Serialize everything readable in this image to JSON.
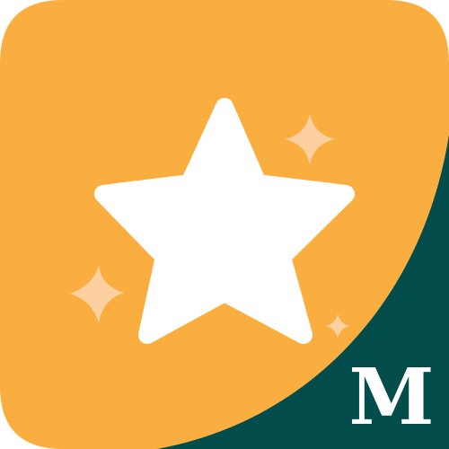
{
  "icon": {
    "name": "star-icon",
    "badge_letter": "M",
    "sparkles": [
      "sparkle-icon",
      "sparkle-icon",
      "sparkle-icon"
    ]
  },
  "colors": {
    "background": "#FBAE40",
    "corner": "#024D4C",
    "star": "#FFFFFF",
    "sparkle": "#FDD0A0",
    "badge_text": "#FFFFFF"
  }
}
